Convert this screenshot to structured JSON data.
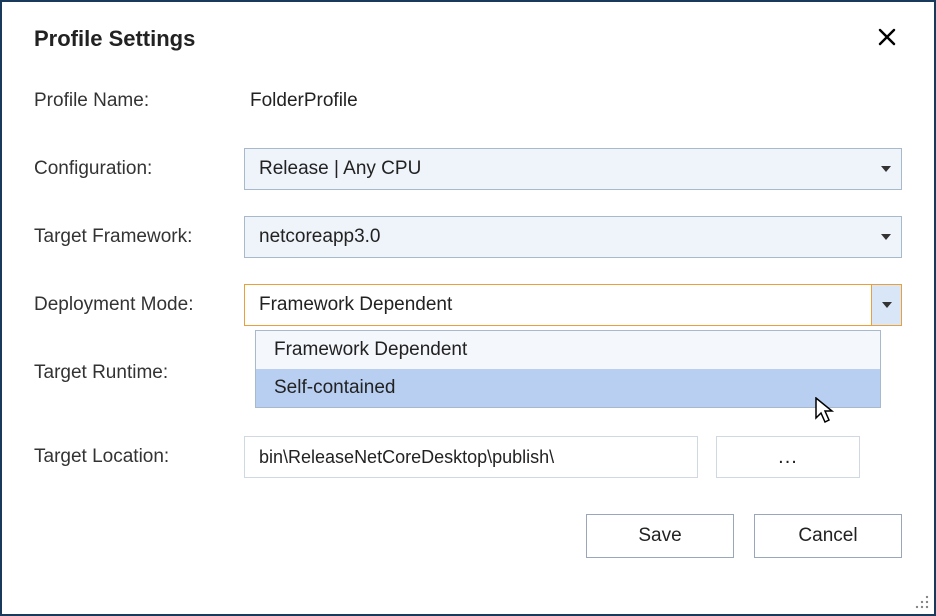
{
  "title": "Profile Settings",
  "labels": {
    "profileName": "Profile Name:",
    "configuration": "Configuration:",
    "targetFramework": "Target Framework:",
    "deploymentMode": "Deployment Mode:",
    "targetRuntime": "Target Runtime:",
    "targetLocation": "Target Location:"
  },
  "values": {
    "profileName": "FolderProfile",
    "configuration": "Release | Any CPU",
    "targetFramework": "netcoreapp3.0",
    "deploymentMode": "Framework Dependent",
    "targetLocation": "bin\\ReleaseNetCoreDesktop\\publish\\"
  },
  "deploymentModeOptions": [
    "Framework Dependent",
    "Self-contained"
  ],
  "buttons": {
    "browse": "...",
    "save": "Save",
    "cancel": "Cancel"
  }
}
